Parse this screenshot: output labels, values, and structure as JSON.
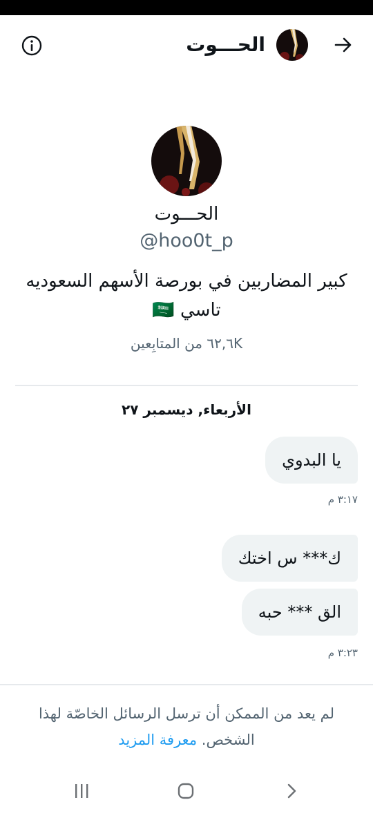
{
  "header": {
    "title": "الحـــوت",
    "back_icon": "arrow-right-icon",
    "info_icon": "info-icon"
  },
  "profile": {
    "name": "الحـــوت",
    "handle": "@hoo0t_p",
    "bio_line1": "كبير المضاربين في بورصة الأسهم  السعوديه",
    "bio_line2": "تاسي 🇸🇦",
    "followers": "٦٢,٦K من المتابِعين"
  },
  "conversation": {
    "date": "الأربعاء, ديسمبر ٢٧",
    "messages": [
      {
        "text": "يا البدوي",
        "time": "٣:١٧ م"
      },
      {
        "text": "ك*** س اختك",
        "time": ""
      },
      {
        "text": "الق *** حبه",
        "time": "٣:٢٣ م"
      }
    ]
  },
  "notice": {
    "text": "لم يعد من الممكن أن ترسل الرسائل الخاصّة لهذا الشخص.",
    "link": "معرفة المزيد"
  },
  "nav": {
    "recents_icon": "recent-apps-icon",
    "home_icon": "home-icon",
    "back_icon": "chevron-back-icon"
  },
  "colors": {
    "accent": "#1d9bf0",
    "bubble": "#eff3f4",
    "muted": "#536471"
  }
}
